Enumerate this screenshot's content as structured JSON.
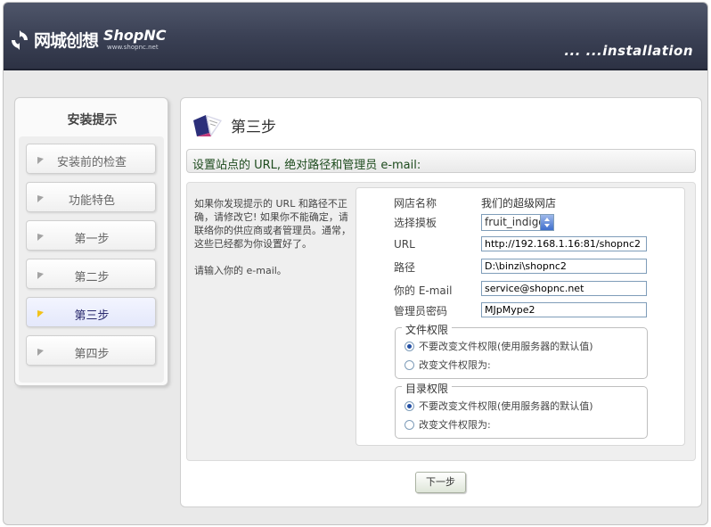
{
  "header": {
    "logo_cn": "网城创想",
    "logo_en": "ShopNC",
    "logo_url": "www.shopnc.net",
    "installation": "... ...installation"
  },
  "sidebar": {
    "title": "安装提示",
    "items": [
      {
        "label": "安装前的检查",
        "active": false
      },
      {
        "label": "功能特色",
        "active": false
      },
      {
        "label": "第一步",
        "active": false
      },
      {
        "label": "第二步",
        "active": false
      },
      {
        "label": "第三步",
        "active": true
      },
      {
        "label": "第四步",
        "active": false
      }
    ]
  },
  "main": {
    "step_title": "第三步",
    "bar_text": "设置站点的 URL, 绝对路径和管理员 e-mail:",
    "hint": [
      "如果你发现提示的 URL 和路径不正确，请修改它! 如果你不能确定，请联络你的供应商或者管理员。通常，这些已经都为你设置好了。",
      "请输入你的 e-mail。"
    ],
    "form": {
      "shop_name_label": "网店名称",
      "shop_name_value": "我们的超级网店",
      "template_label": "选择摸板",
      "template_value": "fruit_indigo",
      "url_label": "URL",
      "url_value": "http://192.168.1.16:81/shopnc2",
      "path_label": "路径",
      "path_value": "D:\\binzi\\shopnc2",
      "email_label": "你的 E-mail",
      "email_value": "service@shopnc.net",
      "password_label": "管理员密码",
      "password_value": "MJpMype2",
      "file_perm": {
        "title": "文件权限",
        "option_keep": "不要改变文件权限(使用服务器的默认值)",
        "option_change": "改变文件权限为:"
      },
      "dir_perm": {
        "title": "目录权限",
        "option_keep": "不要改变文件权限(使用服务器的默认值)",
        "option_change": "改变文件权限为:"
      }
    },
    "next_label": "下一步"
  },
  "colors": {
    "header_bg": "#3b4155",
    "active_arrow": "#f2c21a",
    "bar_text": "#1d4b1d",
    "input_border": "#7f9db9"
  }
}
